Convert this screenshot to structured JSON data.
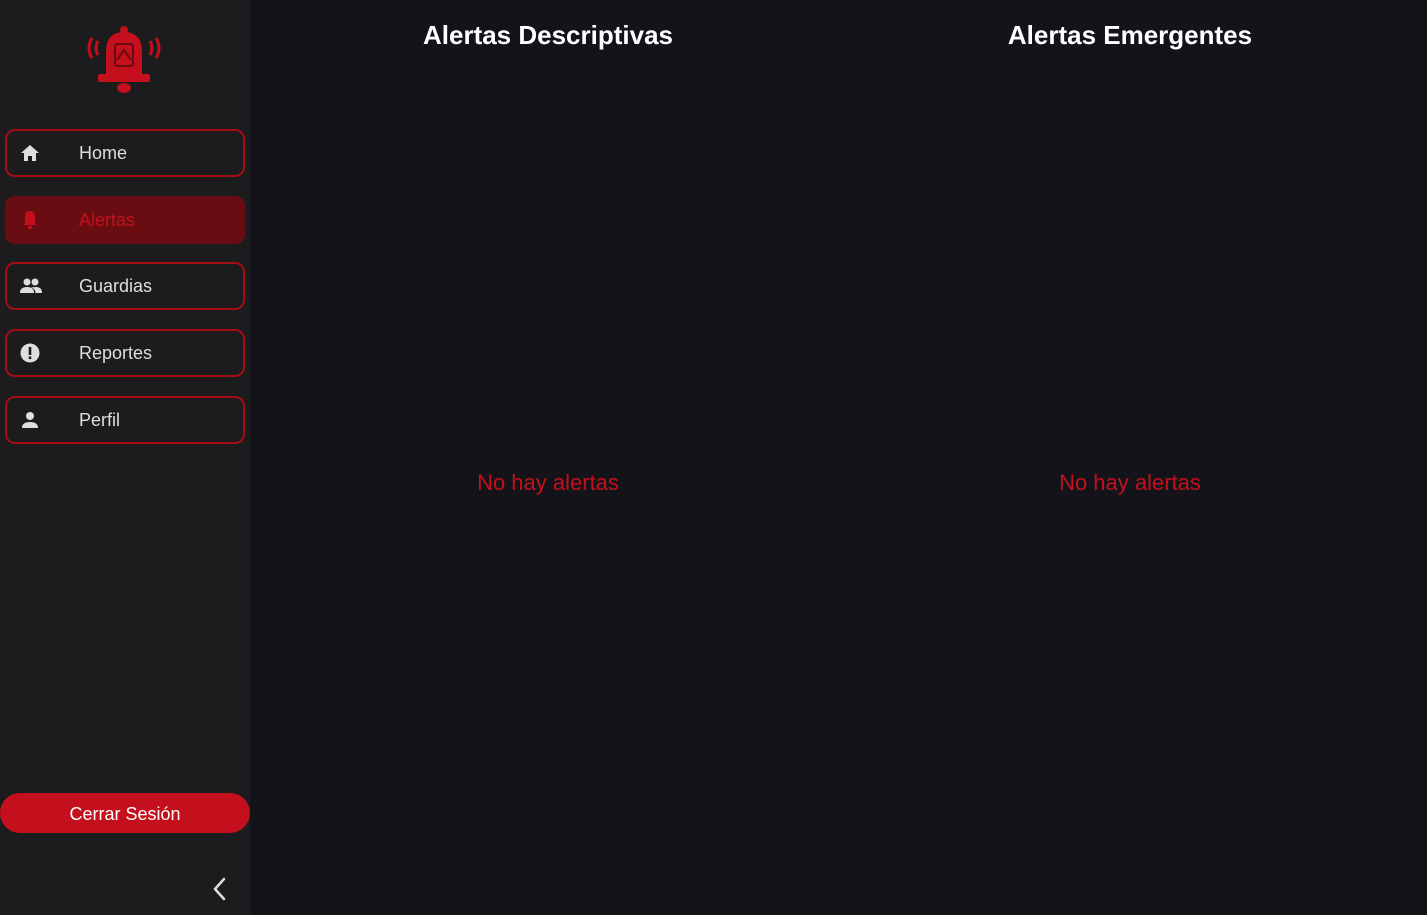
{
  "sidebar": {
    "logo_icon": "alarm-bell-icon",
    "items": [
      {
        "label": "Home",
        "icon": "home-icon",
        "active": false
      },
      {
        "label": "Alertas",
        "icon": "bell-icon",
        "active": true
      },
      {
        "label": "Guardias",
        "icon": "people-icon",
        "active": false
      },
      {
        "label": "Reportes",
        "icon": "alert-circle-icon",
        "active": false
      },
      {
        "label": "Perfil",
        "icon": "person-icon",
        "active": false
      }
    ],
    "logout_label": "Cerrar Sesión",
    "collapse_icon": "chevron-left-icon"
  },
  "main": {
    "descriptive": {
      "title": "Alertas Descriptivas",
      "empty_text": "No hay alertas"
    },
    "emergent": {
      "title": "Alertas Emergentes",
      "empty_text": "No hay alertas"
    }
  },
  "colors": {
    "accent": "#c4101c",
    "active_bg": "#6a0d12",
    "sidebar_bg": "#1c1c1e",
    "main_bg": "#14131a"
  }
}
